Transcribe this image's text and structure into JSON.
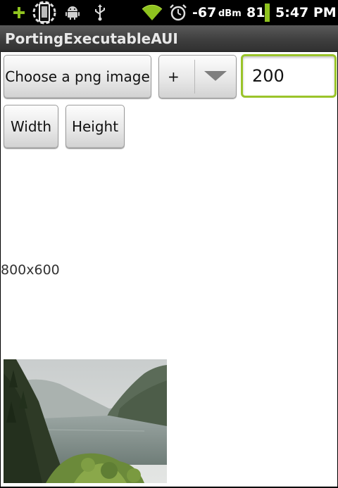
{
  "status_bar": {
    "icons": [
      "add-icon",
      "phone-icon",
      "android-icon",
      "usb-icon",
      "wifi-icon",
      "alarm-icon"
    ],
    "signal_value": "-67",
    "signal_unit": "dBm",
    "battery_level": "81",
    "time": "5:47 PM"
  },
  "app": {
    "title": "PortingExecutableAUI"
  },
  "controls": {
    "choose_button_label": "Choose a png image",
    "operator_spinner_value": "+",
    "amount_field_value": "200",
    "width_button_label": "Width",
    "height_button_label": "Height"
  },
  "image_info": {
    "size_label": "800x600"
  },
  "colors": {
    "status_bar_bg": "#000000",
    "battery_green": "#9ac42a",
    "focus_green": "#9ac42a",
    "title_text": "#e8e8e8"
  }
}
